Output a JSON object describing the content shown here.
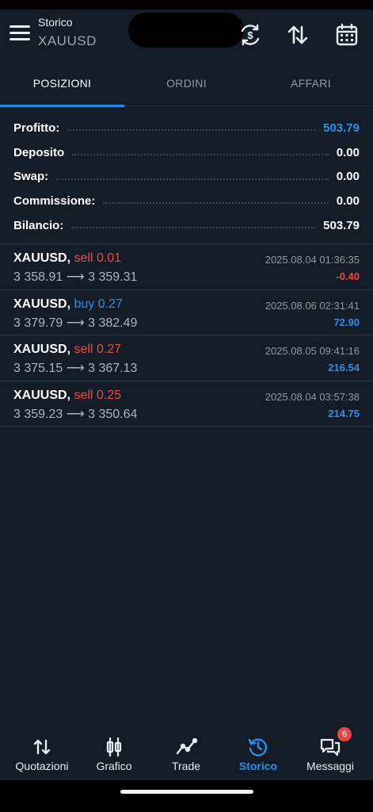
{
  "header": {
    "section_label": "Storico",
    "symbol": "XAUUSD"
  },
  "header_icons": [
    "currency-exchange-icon",
    "sort-arrows-icon",
    "calendar-icon"
  ],
  "tabs": [
    {
      "label": "POSIZIONI",
      "active": true
    },
    {
      "label": "ORDINI",
      "active": false
    },
    {
      "label": "AFFARI",
      "active": false
    }
  ],
  "summary": [
    {
      "label": "Profitto:",
      "value": "503.79",
      "accent": "#2f8fe8"
    },
    {
      "label": "Deposito",
      "value": "0.00"
    },
    {
      "label": "Swap:",
      "value": "0.00"
    },
    {
      "label": "Commissione:",
      "value": "0.00"
    },
    {
      "label": "Bilancio:",
      "value": "503.79"
    }
  ],
  "trades": [
    {
      "symbol": "XAUUSD,",
      "side": "sell",
      "volume": "0.01",
      "open": "3 358.91",
      "close": "3 359.31",
      "datetime": "2025.08.04 01:36:35",
      "profit": "-0.40"
    },
    {
      "symbol": "XAUUSD,",
      "side": "buy",
      "volume": "0.27",
      "open": "3 379.79",
      "close": "3 382.49",
      "datetime": "2025.08.06 02:31:41",
      "profit": "72.90"
    },
    {
      "symbol": "XAUUSD,",
      "side": "sell",
      "volume": "0.27",
      "open": "3 375.15",
      "close": "3 367.13",
      "datetime": "2025.08.05 09:41:16",
      "profit": "216.54"
    },
    {
      "symbol": "XAUUSD,",
      "side": "sell",
      "volume": "0.25",
      "open": "3 359.23",
      "close": "3 350.64",
      "datetime": "2025.08.04 03:57:38",
      "profit": "214.75"
    }
  ],
  "arrow": "⟶",
  "bottom_nav": [
    {
      "label": "Quotazioni",
      "icon": "up-down-arrows-icon"
    },
    {
      "label": "Grafico",
      "icon": "candlestick-icon"
    },
    {
      "label": "Trade",
      "icon": "trend-line-icon"
    },
    {
      "label": "Storico",
      "icon": "history-icon",
      "active": true
    },
    {
      "label": "Messaggi",
      "icon": "chat-icon",
      "badge": "6"
    }
  ],
  "colors": {
    "background": "#131c27",
    "accent_blue": "#2f8fe8",
    "sell_red": "#ee4b4b"
  }
}
